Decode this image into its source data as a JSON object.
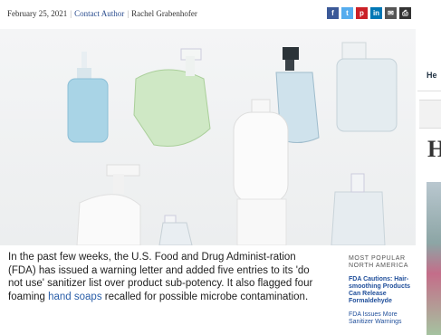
{
  "meta": {
    "date": "February 25, 2021",
    "contact": "Contact Author",
    "author": "Rachel Grabenhofer"
  },
  "share": [
    {
      "name": "facebook",
      "label": "f",
      "color": "#3b5998"
    },
    {
      "name": "twitter",
      "label": "t",
      "color": "#55acee"
    },
    {
      "name": "pinterest",
      "label": "p",
      "color": "#cb2027"
    },
    {
      "name": "linkedin",
      "label": "in",
      "color": "#0077b5"
    },
    {
      "name": "email",
      "label": "✉",
      "color": "#555555"
    },
    {
      "name": "print",
      "label": "⎙",
      "color": "#333333"
    }
  ],
  "article": {
    "text_before": "In the past few weeks, the U.S. Food and Drug Administ-ration (FDA) has issued a warning letter and added five entries to its 'do not use' sanitizer list over product sub-potency. It also flagged four foaming ",
    "link": "hand soaps",
    "text_after": " recalled for possible microbe contamination."
  },
  "popular": {
    "title": "MOST POPULAR NORTH AMERICA",
    "items": [
      "FDA Cautions: Hair-smoothing Products Can Release Formaldehyde",
      "FDA Issues More Sanitizer Warnings"
    ]
  },
  "right_sidebar": {
    "heading_fragment": "He",
    "large_letter": "H"
  }
}
